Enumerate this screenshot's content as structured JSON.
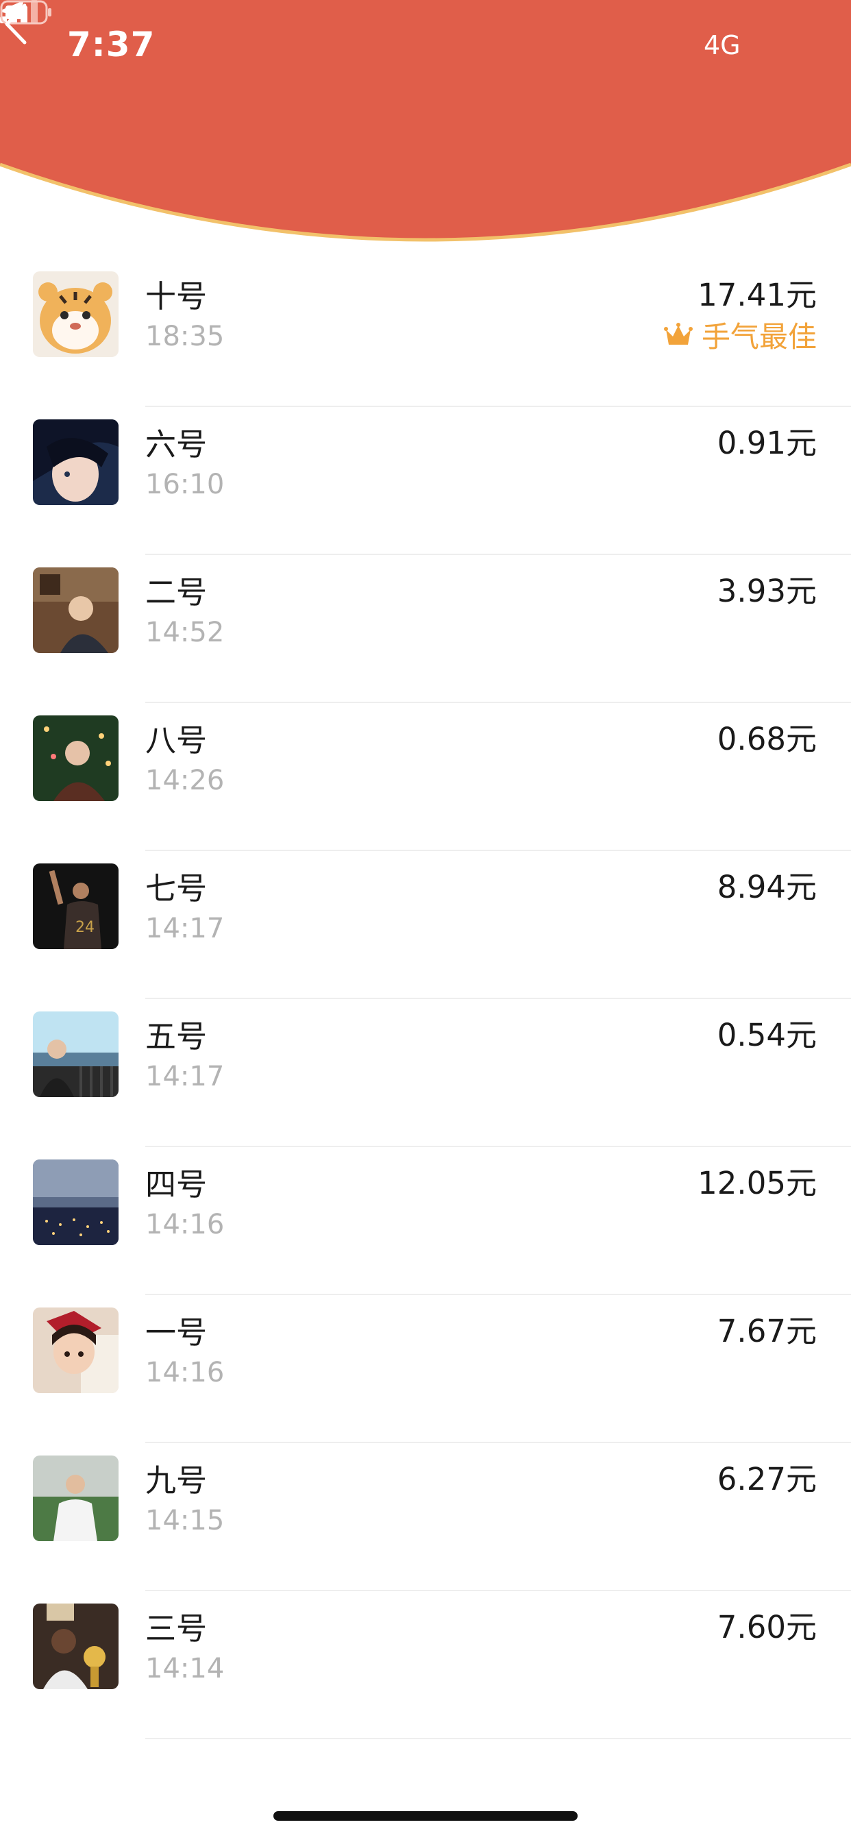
{
  "status_bar": {
    "time": "7:37",
    "network": "4G"
  },
  "colors": {
    "header_red": "#e05e4a",
    "header_edge": "#f2c16a",
    "best_gold": "#f2a33a"
  },
  "nav": {
    "back_icon": "chevron-left-icon"
  },
  "list": [
    {
      "name": "十号",
      "time": "18:35",
      "amount": "17.41元",
      "best_label": "手气最佳",
      "avatar": "tiger-avatar"
    },
    {
      "name": "六号",
      "time": "16:10",
      "amount": "0.91元",
      "avatar": "anime-girl-avatar"
    },
    {
      "name": "二号",
      "time": "14:52",
      "amount": "3.93元",
      "avatar": "man-cafe-avatar"
    },
    {
      "name": "八号",
      "time": "14:26",
      "amount": "0.68元",
      "avatar": "christmas-tree-avatar"
    },
    {
      "name": "七号",
      "time": "14:17",
      "amount": "8.94元",
      "avatar": "basketball-24-avatar"
    },
    {
      "name": "五号",
      "time": "14:17",
      "amount": "0.54元",
      "avatar": "balcony-sea-avatar"
    },
    {
      "name": "四号",
      "time": "14:16",
      "amount": "12.05元",
      "avatar": "city-night-avatar"
    },
    {
      "name": "一号",
      "time": "14:16",
      "amount": "7.67元",
      "avatar": "kiki-anime-avatar"
    },
    {
      "name": "九号",
      "time": "14:15",
      "amount": "6.27元",
      "avatar": "man-white-shirt-avatar"
    },
    {
      "name": "三号",
      "time": "14:14",
      "amount": "7.60元",
      "avatar": "trophy-avatar"
    }
  ]
}
